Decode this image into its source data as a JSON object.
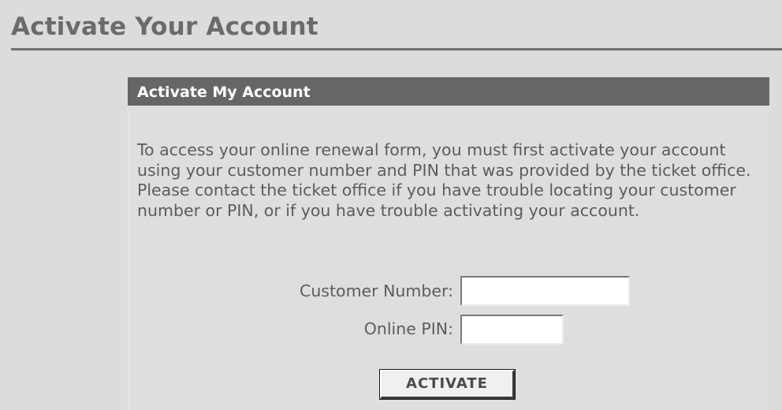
{
  "page": {
    "title": "Activate Your Account"
  },
  "panel": {
    "header": "Activate My Account",
    "intro": "To access your online renewal form, you must first activate your account using your customer number and PIN that was provided by the ticket office. Please contact the ticket office if you have trouble locating your customer number or PIN, or if you have trouble activating your account."
  },
  "form": {
    "customer_number": {
      "label": "Customer Number:",
      "value": ""
    },
    "online_pin": {
      "label": "Online PIN:",
      "value": ""
    },
    "submit_label": "ACTIVATE"
  },
  "colors": {
    "background": "#dcdcdc",
    "header_bar": "#666666",
    "title_text": "#6b6b6b",
    "body_text": "#5c5c5c"
  }
}
